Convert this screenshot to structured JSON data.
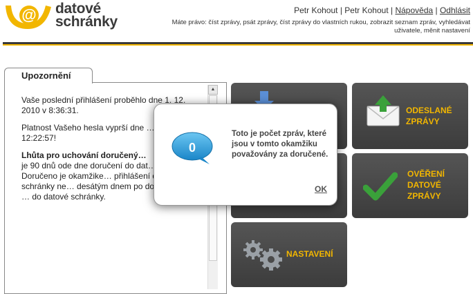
{
  "header": {
    "logo_line1": "datové",
    "logo_line2": "schránky",
    "user_name": "Petr Kohout",
    "user_name2": "Petr Kohout",
    "help_link": "Nápověda",
    "logout_link": "Odhlásit",
    "rights_text": "Máte právo: číst zprávy, psát zprávy, číst zprávy do vlastních rukou, zobrazit seznam zpráv, vyhledávat uživatele, měnit nastavení",
    "accent_color": "#f2b600"
  },
  "notice": {
    "tab_label": "Upozornění",
    "para1": "Vaše poslední přihlášení proběhlo dne 1. 12. 2010 v 8:36:31.",
    "para2": "Platnost Vašeho hesla vyprší dne … 2011 v 12:22:57!",
    "para3_bold": "Lhůta pro uchování doručený…",
    "para3_rest": "je 90 dnů ode dne doručení do dat… schránky. Doručeno je okamžike… přihlášení do datové schránky ne… desátým dnem po dodání zprávy … do datové schránky."
  },
  "tiles": {
    "sent_label_1": "ODESLANÉ",
    "sent_label_2": "ZPRÁVY",
    "verify_label_1": "OVĚŘENÍ",
    "verify_label_2": "DATOVÉ",
    "verify_label_3": "ZPRÁVY",
    "settings_label": "NASTAVENÍ"
  },
  "modal": {
    "count": "0",
    "message": "Toto je počet zpráv, které jsou v tomto okamžiku považovány za doručené.",
    "ok_label": "OK"
  }
}
